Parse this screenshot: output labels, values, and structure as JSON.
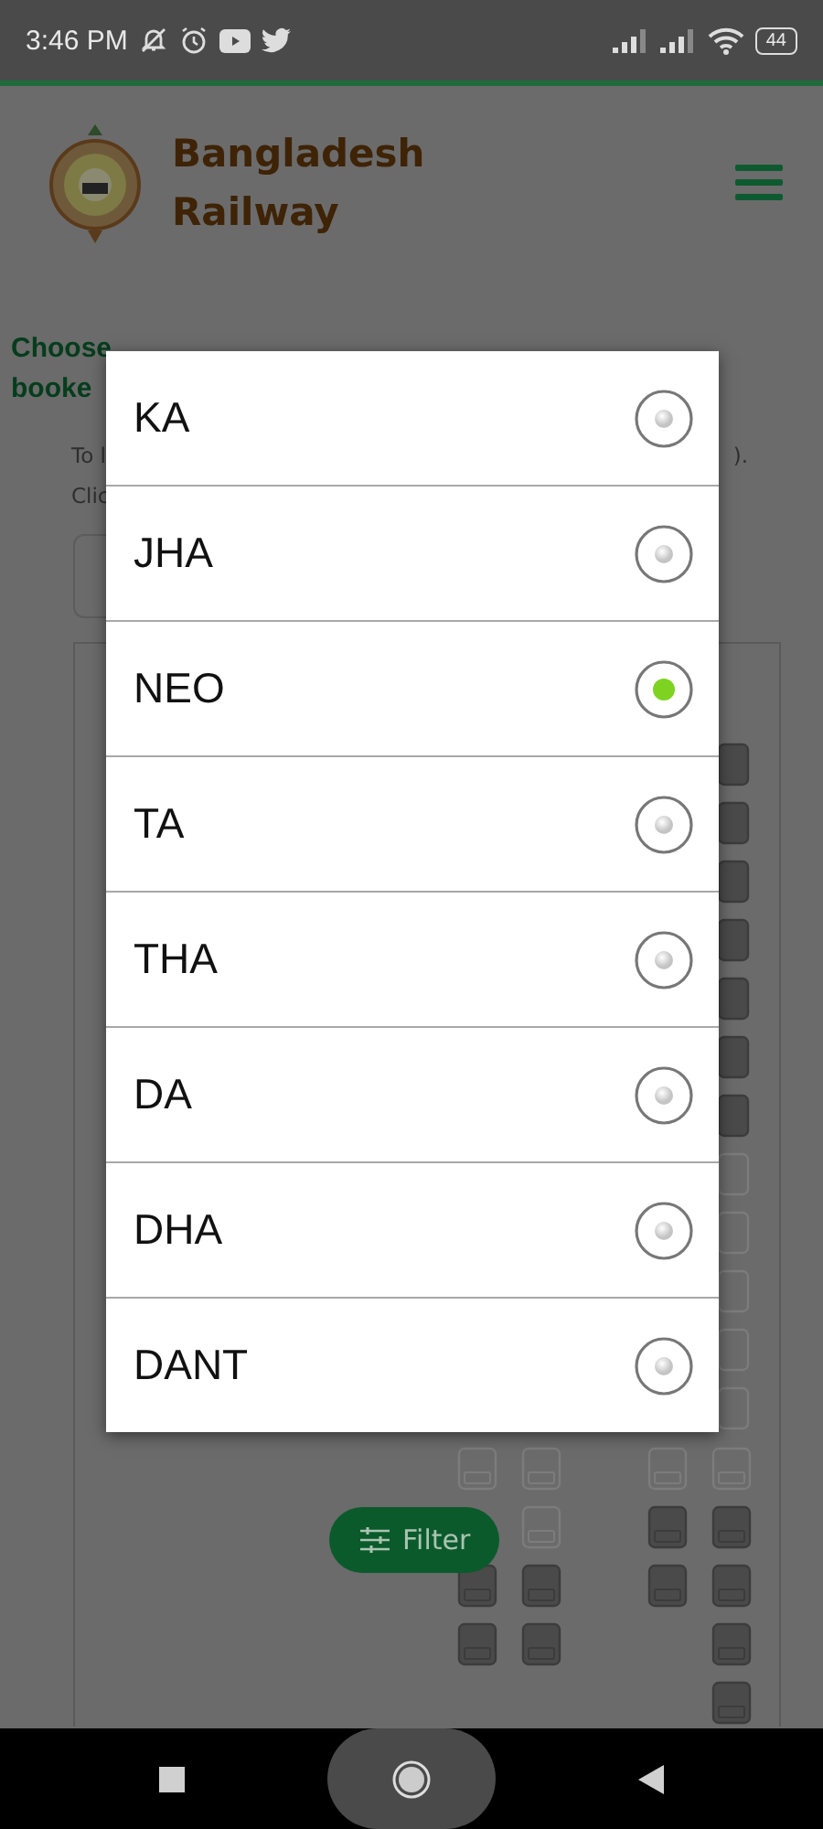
{
  "status_bar": {
    "time": "3:46 PM",
    "battery": "44"
  },
  "header": {
    "title_line_1": "Bangladesh",
    "title_line_2": "Railway"
  },
  "notice": {
    "line_1": "Choose",
    "line_2": "booke"
  },
  "instructions": {
    "line_1_start": "To l",
    "line_1_end": ").",
    "line_2_start": "Clic"
  },
  "filter_button": {
    "label": "Filter"
  },
  "dialog": {
    "options": [
      {
        "label": "KA",
        "selected": false
      },
      {
        "label": "JHA",
        "selected": false
      },
      {
        "label": "NEO",
        "selected": true
      },
      {
        "label": "TA",
        "selected": false
      },
      {
        "label": "THA",
        "selected": false
      },
      {
        "label": "DA",
        "selected": false
      },
      {
        "label": "DHA",
        "selected": false
      },
      {
        "label": "DANT",
        "selected": false
      }
    ]
  }
}
